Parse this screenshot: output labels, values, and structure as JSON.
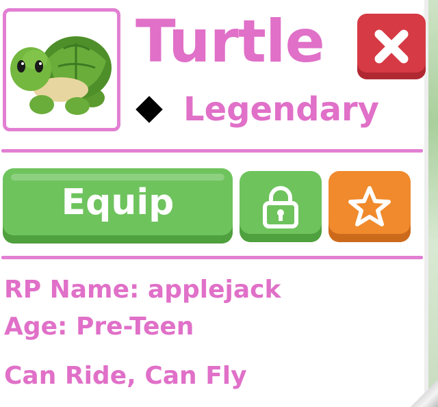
{
  "pet": {
    "name": "Turtle",
    "rarity": "Legendary",
    "rarity_icon": "black-diamond"
  },
  "actions": {
    "equip_label": "Equip",
    "lock_icon": "lock-icon",
    "favorite_icon": "star-icon",
    "close_icon": "close-icon"
  },
  "details": {
    "rp_name": "RP Name: applejack",
    "age": "Age: Pre-Teen",
    "abilities": "Can Ride, Can Fly"
  },
  "colors": {
    "accent_pink": "#e070c8",
    "equip_green": "#6ec35d",
    "favorite_orange": "#f08a2c",
    "close_red": "#d63a44"
  }
}
